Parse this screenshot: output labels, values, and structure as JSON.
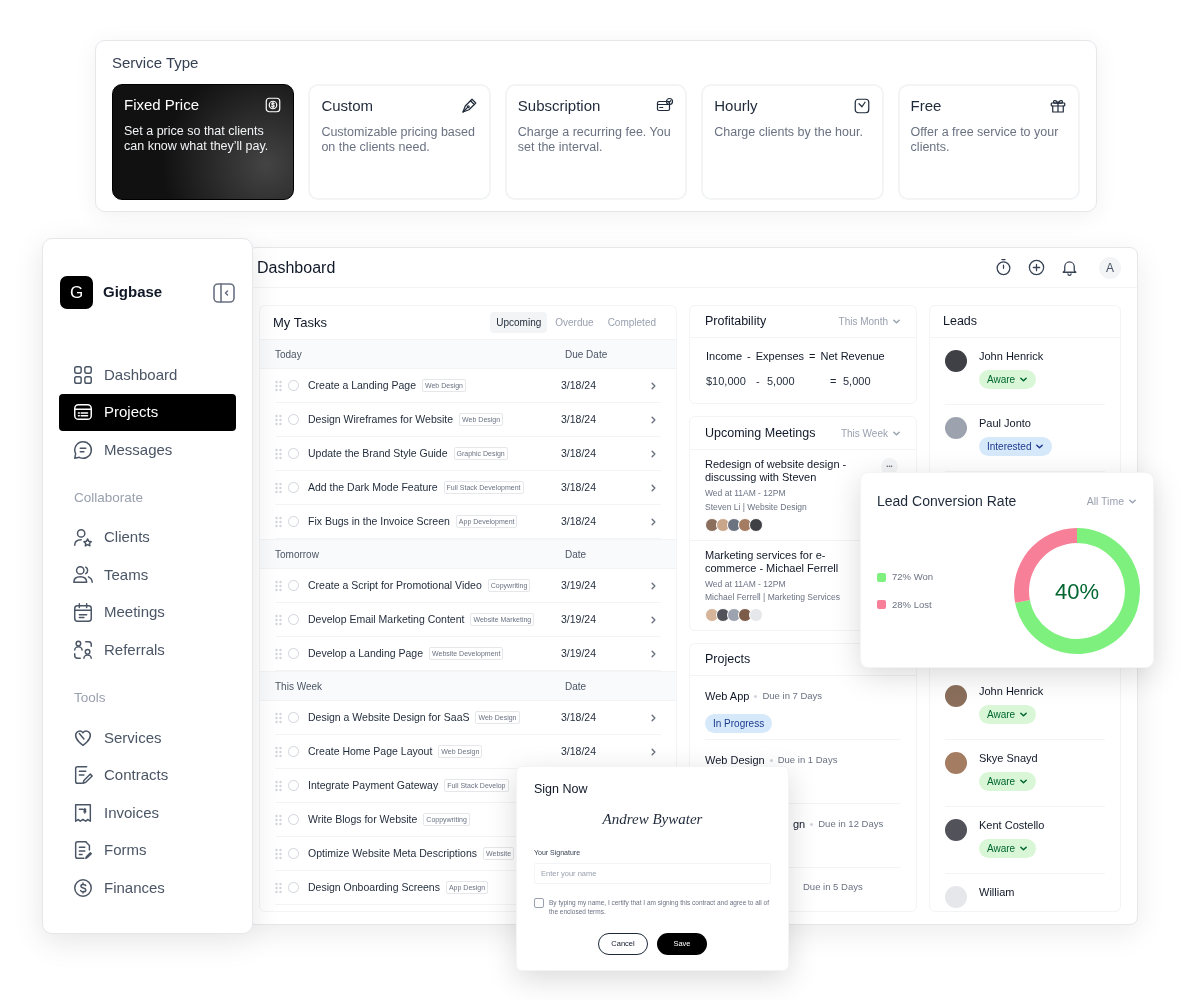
{
  "service_type": {
    "title": "Service Type",
    "options": [
      {
        "title": "Fixed Price",
        "description": "Set a price so that clients can know what they’ll pay.",
        "selected": true
      },
      {
        "title": "Custom",
        "description": "Customizable pricing based on the clients need.",
        "selected": false
      },
      {
        "title": "Subscription",
        "description": "Charge a recurring fee. You set the interval.",
        "selected": false
      },
      {
        "title": "Hourly",
        "description": "Charge clients by the hour.",
        "selected": false
      },
      {
        "title": "Free",
        "description": "Offer a free service to your clients.",
        "selected": false
      }
    ]
  },
  "sidebar": {
    "logo_letter": "G",
    "brand": "Gigbase",
    "sections": [
      {
        "items": [
          {
            "label": "Dashboard",
            "selected": false
          },
          {
            "label": "Projects",
            "selected": true
          },
          {
            "label": "Messages",
            "selected": false
          }
        ]
      },
      {
        "heading": "Collaborate",
        "items": [
          {
            "label": "Clients",
            "selected": false
          },
          {
            "label": "Teams",
            "selected": false
          },
          {
            "label": "Meetings",
            "selected": false
          },
          {
            "label": "Referrals",
            "selected": false
          }
        ]
      },
      {
        "heading": "Tools",
        "items": [
          {
            "label": "Services",
            "selected": false
          },
          {
            "label": "Contracts",
            "selected": false
          },
          {
            "label": "Invoices",
            "selected": false
          },
          {
            "label": "Forms",
            "selected": false
          },
          {
            "label": "Finances",
            "selected": false
          }
        ]
      }
    ]
  },
  "dashboard": {
    "title": "Dashboard",
    "avatar_letter": "A",
    "my_tasks": {
      "title": "My Tasks",
      "tabs": [
        {
          "label": "Upcoming",
          "selected": true
        },
        {
          "label": "Overdue",
          "selected": false
        },
        {
          "label": "Completed",
          "selected": false
        }
      ],
      "groups": [
        {
          "label": "Today",
          "date_header": "Due Date",
          "tasks": [
            {
              "title": "Create a Landing Page",
              "tag": "Web Design",
              "date": "3/18/24",
              "done": false
            },
            {
              "title": "Design Wireframes for Website",
              "tag": "Web Design",
              "date": "3/18/24",
              "done": false
            },
            {
              "title": "Update the Brand Style Guide",
              "tag": "Graphic Design",
              "date": "3/18/24",
              "done": false
            },
            {
              "title": "Add the Dark Mode Feature",
              "tag": "Full Stack Development",
              "date": "3/18/24",
              "done": false
            },
            {
              "title": "Fix Bugs in the Invoice Screen",
              "tag": "App Development",
              "date": "3/18/24",
              "done": false
            }
          ]
        },
        {
          "label": "Tomorrow",
          "date_header": "Date",
          "tasks": [
            {
              "title": "Create a Script for Promotional Video",
              "tag": "Copywriting",
              "date": "3/19/24",
              "done": false
            },
            {
              "title": "Develop Email Marketing Content",
              "tag": "Website Marketing",
              "date": "3/19/24",
              "done": false
            },
            {
              "title": "Develop a Landing Page",
              "tag": "Website Development",
              "date": "3/19/24",
              "done": false
            }
          ]
        },
        {
          "label": "This Week",
          "date_header": "Date",
          "tasks": [
            {
              "title": "Design a Website Design for SaaS",
              "tag": "Web Design",
              "date": "3/18/24",
              "done": false
            },
            {
              "title": "Create Home Page Layout",
              "tag": "Web Design",
              "date": "3/18/24",
              "done": false
            },
            {
              "title": "Integrate Payment Gateway",
              "tag": "Full Stack Develop",
              "done": false
            },
            {
              "title": "Write Blogs for Website",
              "tag": "Coppywriting",
              "done": false
            },
            {
              "title": "Optimize Website Meta Descriptions",
              "tag": "Website",
              "done": false
            },
            {
              "title": "Design Onboarding Screens",
              "tag": "App Design",
              "done": false
            }
          ]
        }
      ]
    },
    "profitability": {
      "title": "Profitability",
      "period": "This Month",
      "headers": [
        "Income",
        "-",
        "Expenses",
        "=",
        "Net Revenue"
      ],
      "values": [
        "$10,000",
        "-",
        "5,000",
        "=",
        "5,000"
      ]
    },
    "meetings": {
      "title": "Upcoming Meetings",
      "period": "This Week",
      "items": [
        {
          "title": "Redesign of website design - discussing with Steven",
          "time": "Wed at 11AM - 12PM",
          "detail": "Steven Li | Website Design",
          "more": "•••"
        },
        {
          "title": "Marketing services for e-commerce - Michael Ferrell",
          "time": "Wed at 11AM - 12PM",
          "detail": "Michael Ferrell | Marketing Services"
        }
      ]
    },
    "projects": {
      "title": "Projects",
      "items": [
        {
          "name": "Web App",
          "due": "Due in 7 Days",
          "status": "In Progress",
          "color": "#d6e9fb"
        },
        {
          "name": "Web Design",
          "due": "Due in 1 Days"
        },
        {
          "name": "gn",
          "due": "Due in 12 Days"
        },
        {
          "due": "Due in 5 Days"
        }
      ]
    },
    "leads": {
      "title": "Leads",
      "items": [
        {
          "name": "John Henrick",
          "status": "Aware",
          "color": "#d9f7d6"
        },
        {
          "name": "Paul Jonto",
          "status": "Interested",
          "color": "#d6e9fb"
        },
        {
          "name": "John Henrick",
          "status": "Aware",
          "color": "#d9f7d6"
        },
        {
          "name": "Skye Snayd",
          "status": "Aware",
          "color": "#d9f7d6"
        },
        {
          "name": "Kent Costello",
          "status": "Aware",
          "color": "#d9f7d6"
        },
        {
          "name": "William"
        }
      ]
    }
  },
  "lead_conversion": {
    "title": "Lead Conversion Rate",
    "period": "All Time",
    "center": "40%",
    "legend": [
      {
        "label": "72% Won",
        "color": "#7ef07e"
      },
      {
        "label": "28% Lost",
        "color": "#f77f97"
      }
    ],
    "chart_data": {
      "type": "donut",
      "values": [
        72,
        28
      ]
    }
  },
  "sign_dialog": {
    "title": "Sign Now",
    "signature": "Andrew Bywater",
    "field_label": "Your Signature",
    "placeholder": "Enter your name",
    "consent": "By typing my name, I certify that I am signing this contract and agree to all of the enclosed terms.",
    "checked": false,
    "buttons": [
      "Cancel",
      "Save"
    ]
  }
}
